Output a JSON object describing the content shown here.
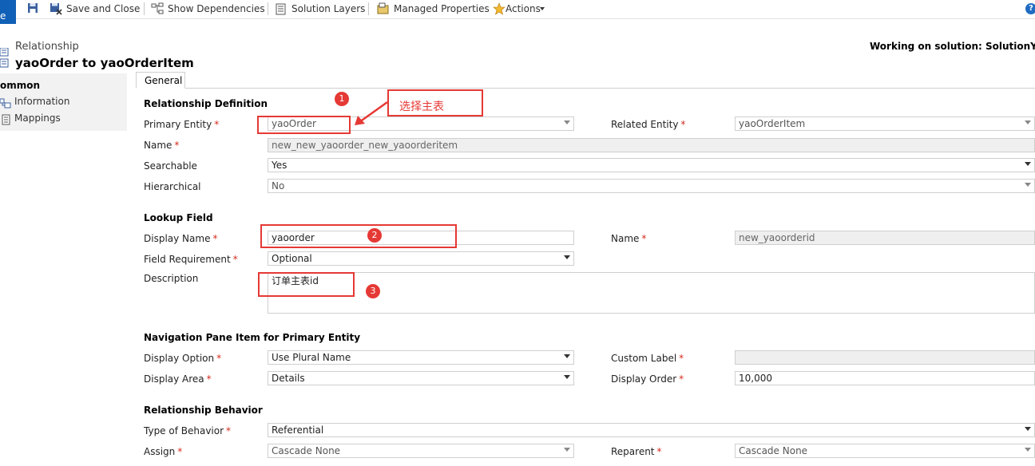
{
  "toolbar": {
    "file_label": "e",
    "save_close": "Save and Close",
    "show_dependencies": "Show Dependencies",
    "solution_layers": "Solution Layers",
    "managed_properties": "Managed Properties",
    "actions": "Actions"
  },
  "header": {
    "entity_type": "Relationship",
    "title": "yaoOrder to yaoOrderItem",
    "working_on": "Working on solution: SolutionYaoHo"
  },
  "nav": {
    "group": "ommon",
    "items": [
      {
        "label": "Information"
      },
      {
        "label": "Mappings"
      }
    ]
  },
  "tabs": {
    "general": "General"
  },
  "relationship_definition": {
    "title": "Relationship Definition",
    "primary_entity": {
      "label": "Primary Entity",
      "value": "yaoOrder"
    },
    "related_entity": {
      "label": "Related Entity",
      "value": "yaoOrderItem"
    },
    "name": {
      "label": "Name",
      "value": "new_new_yaoorder_new_yaoorderitem"
    },
    "searchable": {
      "label": "Searchable",
      "value": "Yes"
    },
    "hierarchical": {
      "label": "Hierarchical",
      "value": "No"
    }
  },
  "lookup_field": {
    "title": "Lookup Field",
    "display_name": {
      "label": "Display Name",
      "value": "yaoorder"
    },
    "name": {
      "label": "Name",
      "value": "new_yaoorderid"
    },
    "field_requirement": {
      "label": "Field Requirement",
      "value": "Optional"
    },
    "description": {
      "label": "Description",
      "value": "订单主表id"
    }
  },
  "navigation_pane": {
    "title": "Navigation Pane Item for Primary Entity",
    "display_option": {
      "label": "Display Option",
      "value": "Use Plural Name"
    },
    "custom_label": {
      "label": "Custom Label",
      "value": ""
    },
    "display_area": {
      "label": "Display Area",
      "value": "Details"
    },
    "display_order": {
      "label": "Display Order",
      "value": "10,000"
    }
  },
  "relationship_behavior": {
    "title": "Relationship Behavior",
    "type_of_behavior": {
      "label": "Type of Behavior",
      "value": "Referential"
    },
    "assign": {
      "label": "Assign",
      "value": "Cascade None"
    },
    "reparent": {
      "label": "Reparent",
      "value": "Cascade None"
    }
  },
  "annotations": {
    "note": "选择主表",
    "step1": "1",
    "step2": "2",
    "step3": "3",
    "color": "#e53935"
  },
  "colors": {
    "accent": "#1160b7",
    "required": "#d52b1e"
  }
}
